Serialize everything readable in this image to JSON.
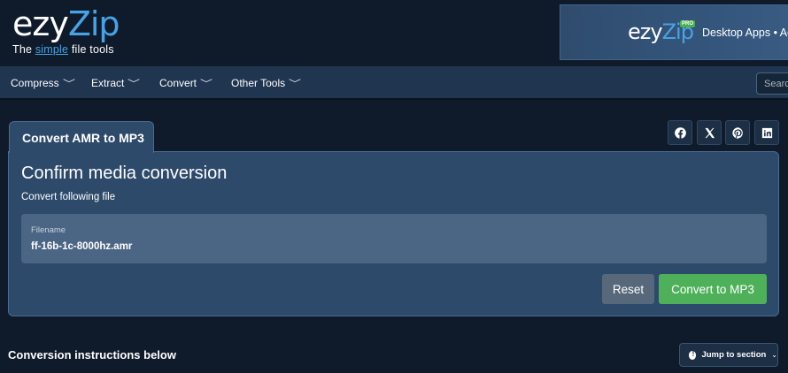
{
  "header": {
    "logo": {
      "ezy": "ezy",
      "zip": "Zip",
      "tag_pre": "The ",
      "tag_simple": "simple",
      "tag_post": " file tools"
    },
    "ad": {
      "ezy": "ezy",
      "zip": "Zip",
      "pro": "PRO",
      "text": "Desktop Apps • Ad-Free"
    }
  },
  "nav": {
    "items": [
      {
        "label": "Compress"
      },
      {
        "label": "Extract"
      },
      {
        "label": "Convert"
      },
      {
        "label": "Other Tools"
      }
    ],
    "search_placeholder": "Search"
  },
  "tab": {
    "label": "Convert AMR to MP3"
  },
  "social": {
    "icons": [
      "facebook-icon",
      "x-icon",
      "pinterest-icon",
      "linkedin-icon"
    ]
  },
  "panel": {
    "title": "Confirm media conversion",
    "subtitle": "Convert following file",
    "file_label": "Filename",
    "file_name": "ff-16b-1c-8000hz.amr",
    "reset_label": "Reset",
    "convert_label": "Convert to MP3"
  },
  "bottom": {
    "instructions": "Conversion instructions below",
    "jump_label": "Jump to section"
  },
  "colors": {
    "background": "#0f1b2a",
    "navbar": "#1f3550",
    "panel": "#2d4a6b",
    "accent_blue": "#47a3e6",
    "convert_green": "#4fb05a",
    "reset_gray": "#566879"
  }
}
